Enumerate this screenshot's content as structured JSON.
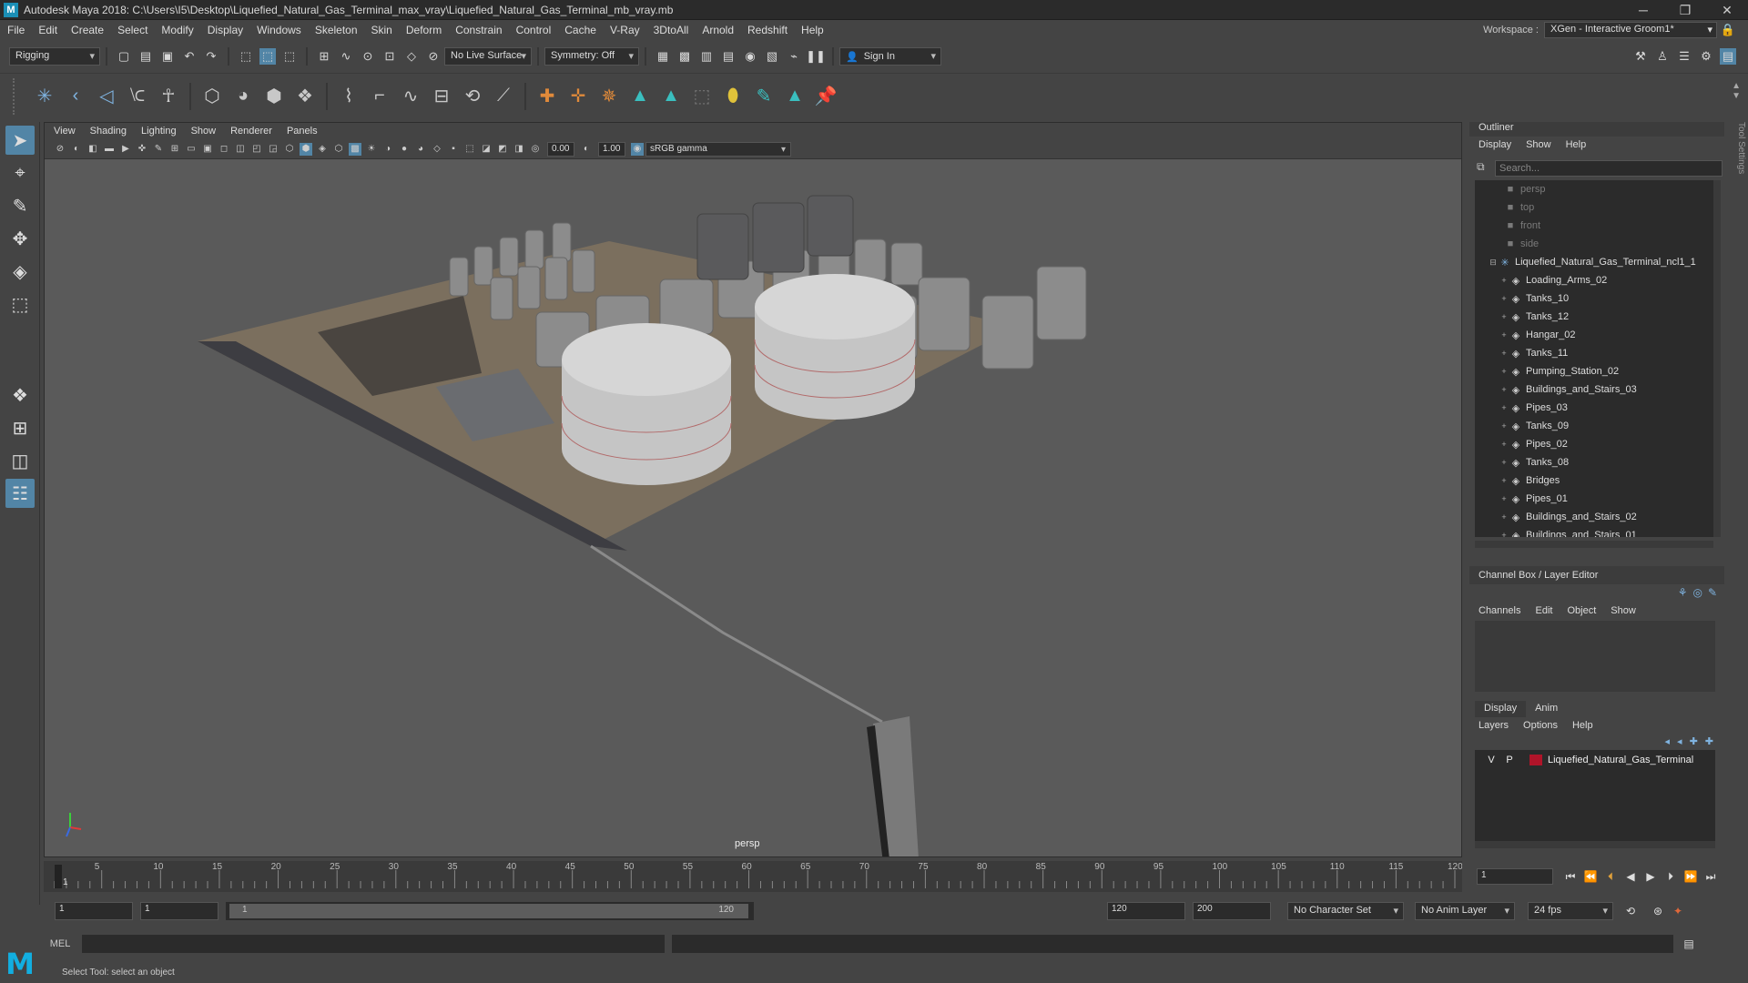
{
  "window": {
    "title": "Autodesk Maya 2018: C:\\Users\\I5\\Desktop\\Liquefied_Natural_Gas_Terminal_max_vray\\Liquefied_Natural_Gas_Terminal_mb_vray.mb",
    "app_icon": "M",
    "min": "─",
    "max": "❐",
    "close": "✕"
  },
  "menubar": {
    "items": [
      "File",
      "Edit",
      "Create",
      "Select",
      "Modify",
      "Display",
      "Windows",
      "Skeleton",
      "Skin",
      "Deform",
      "Constrain",
      "Control",
      "Cache",
      "V-Ray",
      "3DtoAll",
      "Arnold",
      "Redshift",
      "Help"
    ],
    "workspace_label": "Workspace :",
    "workspace_value": "XGen - Interactive Groom1*"
  },
  "statusline": {
    "menuset": "Rigging",
    "live_surface": "No Live Surface",
    "symmetry": "Symmetry: Off",
    "sign_in": "Sign In"
  },
  "viewport": {
    "menu": [
      "View",
      "Shading",
      "Lighting",
      "Show",
      "Renderer",
      "Panels"
    ],
    "exposure": "0.00",
    "gamma": "1.00",
    "colorspace": "sRGB gamma",
    "camera_label": "persp"
  },
  "outliner": {
    "title": "Outliner",
    "menu": [
      "Display",
      "Show",
      "Help"
    ],
    "search_placeholder": "Search...",
    "cameras": [
      "persp",
      "top",
      "front",
      "side"
    ],
    "root": "Liquefied_Natural_Gas_Terminal_ncl1_1",
    "children": [
      "Loading_Arms_02",
      "Tanks_10",
      "Tanks_12",
      "Hangar_02",
      "Tanks_11",
      "Pumping_Station_02",
      "Buildings_and_Stairs_03",
      "Pipes_03",
      "Tanks_09",
      "Pipes_02",
      "Tanks_08",
      "Bridges",
      "Pipes_01",
      "Buildings_and_Stairs_02",
      "Buildings_and_Stairs_01"
    ]
  },
  "channel_box": {
    "title": "Channel Box / Layer Editor",
    "menu": [
      "Channels",
      "Edit",
      "Object",
      "Show"
    ]
  },
  "layer_editor": {
    "tabs": [
      "Display",
      "Anim"
    ],
    "menu": [
      "Layers",
      "Options",
      "Help"
    ],
    "layer": {
      "v": "V",
      "p": "P",
      "name": "Liquefied_Natural_Gas_Terminal",
      "color": "#b01429"
    }
  },
  "side_tab": "Tool Settings",
  "timeline": {
    "ticks": [
      5,
      10,
      15,
      20,
      25,
      30,
      35,
      40,
      45,
      50,
      55,
      60,
      65,
      70,
      75,
      80,
      85,
      90,
      95,
      100,
      105,
      110,
      115,
      120
    ],
    "current_marker": "1",
    "current_frame": "1"
  },
  "range": {
    "start": "1",
    "playback_start": "1",
    "range_start": "1",
    "range_end": "120",
    "playback_end": "120",
    "end": "200",
    "character_set": "No Character Set",
    "anim_layer": "No Anim Layer",
    "fps": "24 fps"
  },
  "cmdline": {
    "label": "MEL"
  },
  "helpline": {
    "text": "Select Tool: select an object"
  },
  "logo": "M"
}
